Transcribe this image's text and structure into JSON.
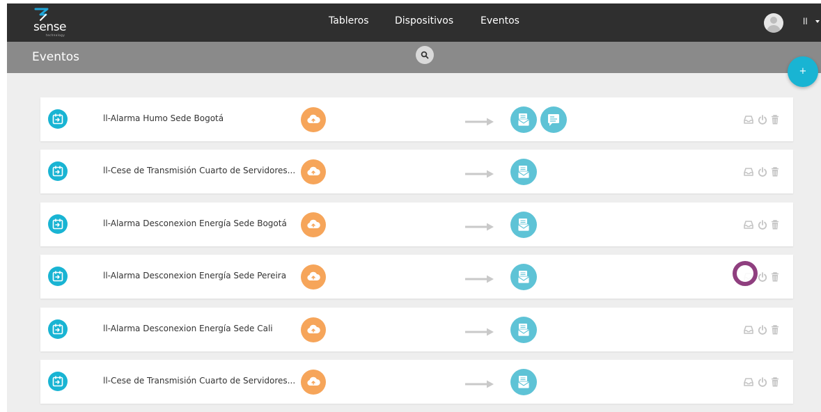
{
  "app": {
    "logo_text": "sense",
    "logo_tag": "technology"
  },
  "nav": {
    "items": [
      "Tableros",
      "Dispositivos",
      "Eventos"
    ]
  },
  "user": {
    "name": "ll"
  },
  "subheader": {
    "title": "Eventos"
  },
  "fab": {
    "label": "+"
  },
  "events": [
    {
      "name": "ll-Alarma Humo Sede Bogotá",
      "trigger_icon": "cloud-upload-icon",
      "actions": [
        "email-icon",
        "message-icon"
      ]
    },
    {
      "name": "ll-Cese de Transmisión Cuarto de Servidores...",
      "trigger_icon": "cloud-upload-icon",
      "actions": [
        "email-icon"
      ]
    },
    {
      "name": "ll-Alarma Desconexion Energía Sede Bogotá",
      "trigger_icon": "cloud-upload-icon",
      "actions": [
        "email-icon"
      ]
    },
    {
      "name": "ll-Alarma Desconexion Energía Sede Pereira",
      "trigger_icon": "cloud-upload-icon",
      "actions": [
        "email-icon"
      ]
    },
    {
      "name": "ll-Alarma Desconexion Energía Sede Cali",
      "trigger_icon": "cloud-upload-icon",
      "actions": [
        "email-icon"
      ]
    },
    {
      "name": "ll-Cese de Transmisión Cuarto de Servidores...",
      "trigger_icon": "cloud-upload-icon",
      "actions": [
        "email-icon"
      ]
    }
  ],
  "row_tools": [
    "inbox-icon",
    "power-icon",
    "trash-icon"
  ],
  "colors": {
    "topbar": "#2f2f2f",
    "subbar": "#8a8a8a",
    "accent": "#19b4d3",
    "trigger": "#f6a55a",
    "action": "#5ec3d6",
    "background": "#eeeeee"
  }
}
